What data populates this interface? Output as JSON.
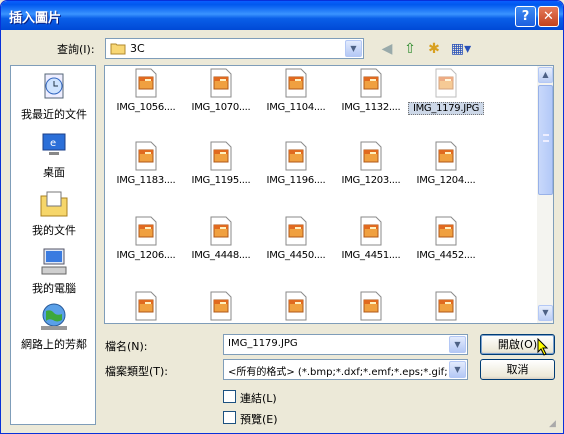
{
  "dialog": {
    "title": "插入圖片",
    "help_label": "?",
    "close_label": "✕"
  },
  "lookin": {
    "label": "查詢(I):",
    "value": "3C"
  },
  "toolbar": [
    "back-icon",
    "up-folder-icon",
    "new-folder-icon",
    "view-menu-icon"
  ],
  "places": [
    {
      "label": "我最近的文件",
      "icon": "recent-documents-icon"
    },
    {
      "label": "桌面",
      "icon": "desktop-icon"
    },
    {
      "label": "我的文件",
      "icon": "my-documents-icon"
    },
    {
      "label": "我的電腦",
      "icon": "my-computer-icon"
    },
    {
      "label": "網路上的芳鄰",
      "icon": "network-places-icon"
    }
  ],
  "files": [
    "IMG_1056....",
    "IMG_1070....",
    "IMG_1104....",
    "IMG_1132....",
    "IMG_1179.JPG",
    "IMG_1183....",
    "IMG_1195....",
    "IMG_1196....",
    "IMG_1203....",
    "IMG_1204....",
    "IMG_1206....",
    "IMG_4448....",
    "IMG_4450....",
    "IMG_4451....",
    "IMG_4452....",
    "",
    "",
    "",
    "",
    ""
  ],
  "selected_file": "IMG_1179.JPG",
  "filename": {
    "label": "檔名(N):",
    "value": "IMG_1179.JPG"
  },
  "filetype": {
    "label": "檔案類型(T):",
    "value": "<所有的格式> (*.bmp;*.dxf;*.emf;*.eps;*.gif;"
  },
  "buttons": {
    "open": "開啟(O)",
    "cancel": "取消"
  },
  "options": {
    "link": "連結(L)",
    "preview": "預覽(E)"
  },
  "colors": {
    "title_bar": "#0058ee",
    "selection": "#cdd8e8",
    "dialog_bg": "#ece9d8"
  }
}
